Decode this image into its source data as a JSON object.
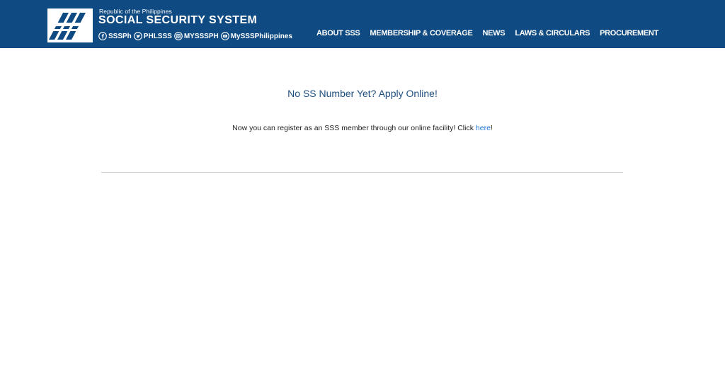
{
  "header": {
    "republic": "Republic of the Philippines",
    "agency": "SOCIAL SECURITY SYSTEM",
    "background_color": "#0f4b82",
    "socials": [
      {
        "icon": "facebook-icon",
        "label": "SSSPh"
      },
      {
        "icon": "twitter-icon",
        "label": "PHLSSS"
      },
      {
        "icon": "instagram-icon",
        "label": "MYSSSPH"
      },
      {
        "icon": "youtube-icon",
        "label": "MySSSPhilippines"
      }
    ]
  },
  "nav": {
    "items": [
      "ABOUT SSS",
      "MEMBERSHIP & COVERAGE",
      "NEWS",
      "LAWS & CIRCULARS",
      "PROCUREMENT"
    ]
  },
  "main": {
    "headline": "No SS Number Yet? Apply Online!",
    "description_before": "Now you can register as an SSS member through our online facility! Click ",
    "link_text": "here",
    "description_after": "!",
    "link_color": "#1a73d9"
  }
}
